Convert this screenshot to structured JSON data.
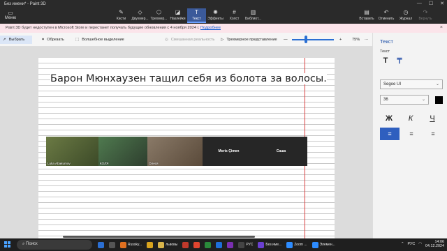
{
  "window": {
    "title": "Без имени* - Paint 3D",
    "controls": [
      "—",
      "☐",
      "✕"
    ]
  },
  "ribbon": {
    "menu_label": "Меню",
    "tools": [
      {
        "label": "Кисти",
        "icon": "brush-icon"
      },
      {
        "label": "Двухмер...",
        "icon": "shapes-2d-icon"
      },
      {
        "label": "Трехмер...",
        "icon": "shapes-3d-icon"
      },
      {
        "label": "Наклейки",
        "icon": "stickers-icon"
      },
      {
        "label": "Текст",
        "icon": "text-icon",
        "active": true
      },
      {
        "label": "Эффекты",
        "icon": "effects-icon"
      },
      {
        "label": "Холст",
        "icon": "canvas-icon"
      },
      {
        "label": "Библиот...",
        "icon": "library-icon"
      }
    ],
    "right_tools": [
      {
        "label": "Вставить",
        "icon": "paste-icon"
      },
      {
        "label": "Отменить",
        "icon": "undo-icon"
      },
      {
        "label": "Журнал",
        "icon": "history-icon"
      },
      {
        "label": "Вернуть",
        "icon": "redo-icon",
        "disabled": true
      }
    ]
  },
  "notice": {
    "text": "Paint 3D будет недоступен в Microsoft Store и перестанет получать будущие обновления с 4 ноября 2024 г.",
    "link": "Подробнее"
  },
  "toolbar": {
    "select": "Выбрать",
    "crop": "Обрезать",
    "magic_select": "Волшебное выделение",
    "mixed_reality": "Смешанная реальность",
    "view_3d": "Трехмерное представление",
    "zoom_minus": "—",
    "zoom_plus": "+",
    "zoom_value": "75%",
    "more": "···",
    "zoom_level_fraction": 0.33
  },
  "canvas": {
    "text": "Барон Мюнхаузен тащил себя из болота за волосы.",
    "video_tiles": [
      {
        "label": "Luka Abakumov",
        "kind": "photo",
        "color": "#5a6b3a"
      },
      {
        "label": "КОЛЯ",
        "kind": "photo",
        "color": "#4a6a4a"
      },
      {
        "label": "Олеся",
        "kind": "photo",
        "color": "#7a6a5a"
      },
      {
        "label": "Moris Çimen",
        "kind": "name"
      },
      {
        "label": "Саша",
        "kind": "name"
      }
    ]
  },
  "panel": {
    "title": "Текст",
    "sub": "Текст",
    "font": "Segoe UI",
    "size": "36",
    "color": "#000000",
    "bold": "Ж",
    "italic": "К",
    "underline": "Ч"
  },
  "taskbar": {
    "search": "Поиск",
    "apps": [
      {
        "label": "",
        "color": "#2b6fd3"
      },
      {
        "label": "",
        "color": "#555"
      },
      {
        "label": "Russky...",
        "color": "#e07020"
      },
      {
        "label": "",
        "color": "#d9a41e"
      },
      {
        "label": "львовы",
        "color": "#d9b44a"
      },
      {
        "label": "",
        "color": "#c0392b"
      },
      {
        "label": "",
        "color": "#e0452f"
      },
      {
        "label": "",
        "color": "#2a8a3a"
      },
      {
        "label": "",
        "color": "#1e6fd9"
      },
      {
        "label": "",
        "color": "#7a2fb0"
      },
      {
        "label": "РУС",
        "color": "#444"
      },
      {
        "label": "Без име...",
        "color": "#6a3fd0"
      },
      {
        "label": "Zoom ...",
        "color": "#2d8cff"
      },
      {
        "label": "Элемен...",
        "color": "#2d8cff"
      }
    ],
    "lang": "РУС",
    "time": "14:06",
    "date": "04.12.2024"
  }
}
